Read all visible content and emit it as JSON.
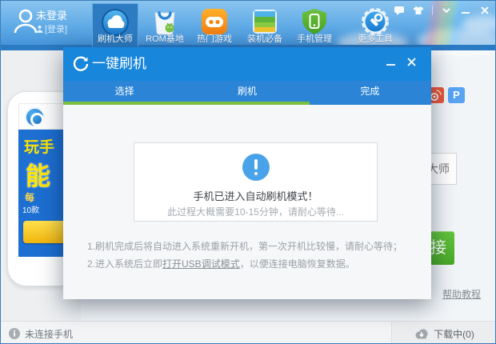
{
  "colors": {
    "dialog_header_blue": "#1886db",
    "tab_bar_blue": "#2b84d6",
    "progress_green": "#7cc13e",
    "info_blue": "#4aa3e9",
    "connect_green": "#55b72f",
    "banner_yellow": "#ffe400"
  },
  "user": {
    "name": "未登录",
    "login_label": "[登录]"
  },
  "toolbar": {
    "items": [
      {
        "label": "刷机大师",
        "icon": "cloud-icon",
        "active": true
      },
      {
        "label": "ROM基地",
        "icon": "rom-bag-icon",
        "active": false
      },
      {
        "label": "热门游戏",
        "icon": "game-controller-icon",
        "active": false
      },
      {
        "label": "装机必备",
        "icon": "stacked-apps-icon",
        "active": false
      },
      {
        "label": "手机管理",
        "icon": "shield-phone-icon",
        "active": false
      },
      {
        "label": "更多工具",
        "icon": "gear-wrench-icon",
        "active": false
      }
    ]
  },
  "window_controls": [
    "message-icon",
    "shirt-skin-icon",
    "chevron-down-icon",
    "minimize-icon",
    "close-icon"
  ],
  "dialog": {
    "title": "一键刷机",
    "tabs": [
      {
        "label": "选择"
      },
      {
        "label": "刷机"
      },
      {
        "label": "完成"
      }
    ],
    "progress_percent": 67,
    "status_title": "手机已进入自动刷机模式！",
    "status_subtitle": "此过程大概需要10-15分钟，请耐心等待...",
    "tips": [
      {
        "prefix": "1.刷机完成后将自动进入系统重新开机，第一次开机比较慢，请耐心等待；",
        "link": "",
        "suffix": ""
      },
      {
        "prefix": "2.进入系统后立即",
        "link": "打开USB调试模式",
        "suffix": "，以便连接电脑恢复数据。"
      }
    ]
  },
  "phone_banner": {
    "frag1": "玩手",
    "frag2": "能",
    "frag3": "每",
    "frag4": "10款"
  },
  "side_fragments": {
    "social_p_label": "P",
    "box_fragment": "大师",
    "button_fragment": "接",
    "help_fragment": "帮助教程"
  },
  "statusbar": {
    "connection": "未连接手机",
    "download": "下载中(0)"
  }
}
